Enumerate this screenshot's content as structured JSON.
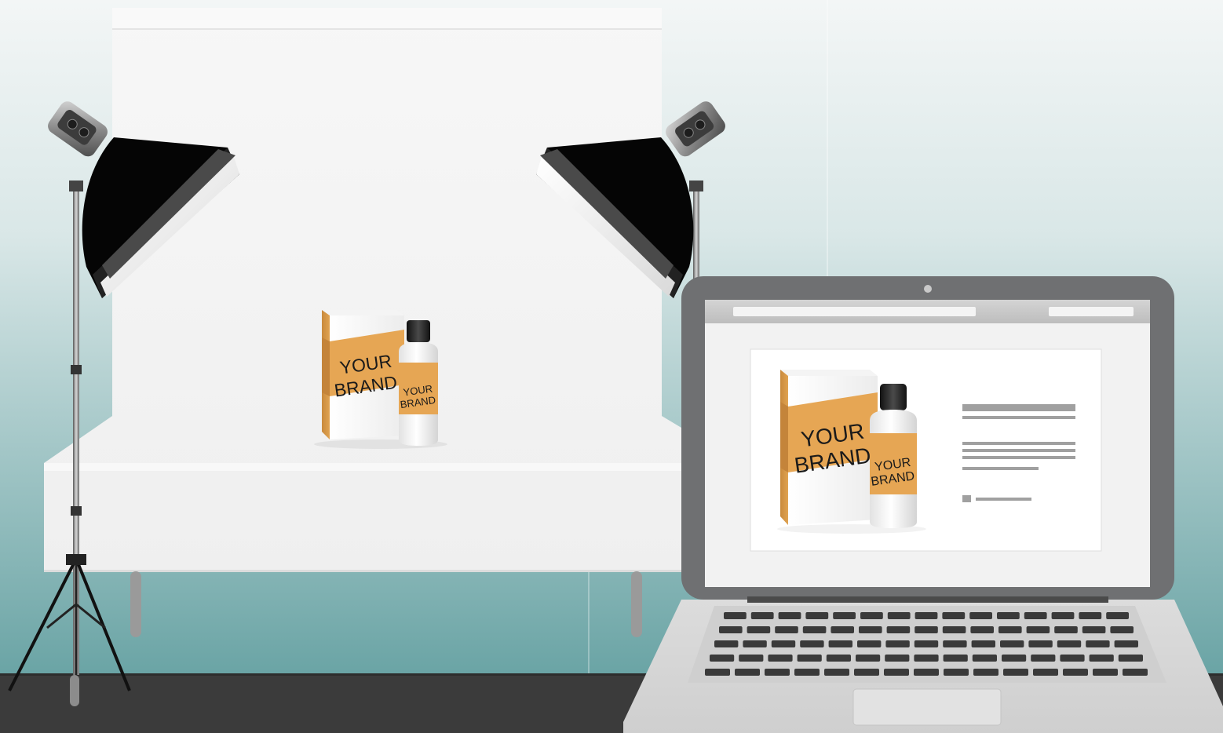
{
  "scene": {
    "brand_box_line1": "YOUR",
    "brand_box_line2": "BRAND",
    "brand_bottle_line1": "YOUR",
    "brand_bottle_line2": "BRAND"
  },
  "laptop_screen": {
    "brand_box_line1": "YOUR",
    "brand_box_line2": "BRAND",
    "brand_bottle_line1": "YOUR",
    "brand_bottle_line2": "BRAND"
  },
  "colors": {
    "wall_top": "#f1f4f5",
    "wall_bottom": "#6fa7a8",
    "floor": "#3a3a3a",
    "brand_orange": "#e6a654",
    "laptop_gray": "#6f7072"
  }
}
